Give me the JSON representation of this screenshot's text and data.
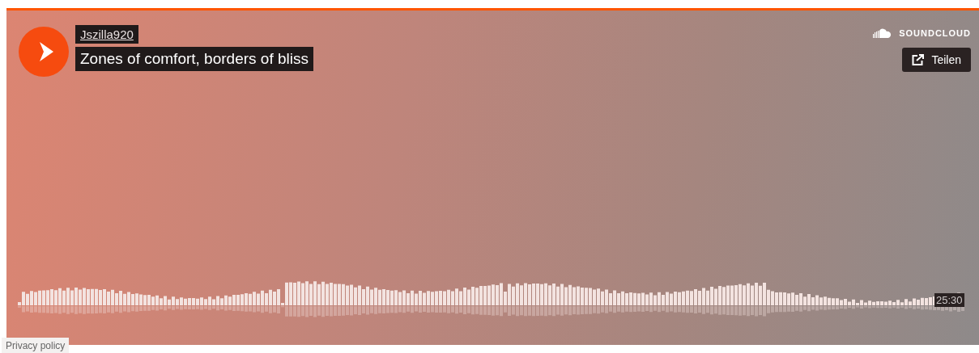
{
  "player": {
    "user": "Jszilla920",
    "title": "Zones of comfort, borders of bliss",
    "brand": "SOUNDCLOUD",
    "share_button": "Teilen",
    "duration": "25:30"
  },
  "privacy_link": "Privacy policy"
}
